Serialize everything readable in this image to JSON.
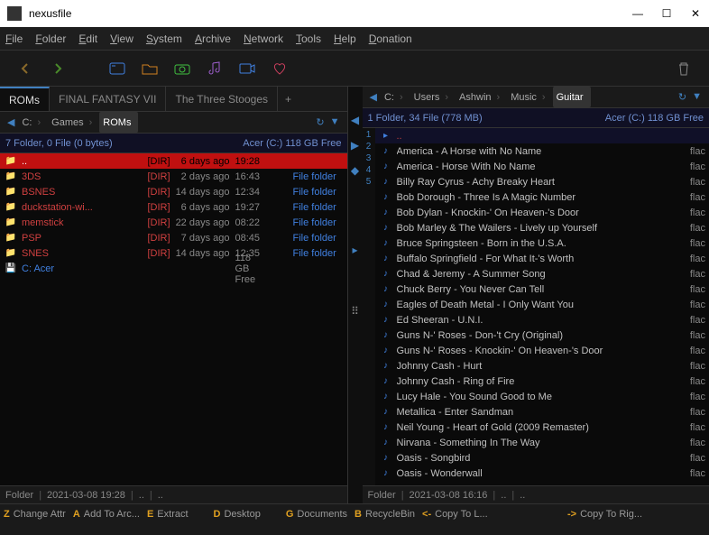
{
  "window": {
    "title": "nexusfile"
  },
  "menu": [
    "File",
    "Folder",
    "Edit",
    "View",
    "System",
    "Archive",
    "Network",
    "Tools",
    "Help",
    "Donation"
  ],
  "left": {
    "tabs": [
      {
        "label": "ROMs",
        "active": true
      },
      {
        "label": "FINAL FANTASY VII",
        "active": false
      },
      {
        "label": "The Three Stooges",
        "active": false
      }
    ],
    "breadcrumb": [
      "C:",
      "Games",
      "ROMs"
    ],
    "info_left": "7 Folder, 0 File (0 bytes)",
    "info_right": "Acer (C:) 118 GB Free",
    "rows": [
      {
        "name": "..",
        "dir": "[DIR]",
        "ago": "6 days ago",
        "time": "19:28",
        "bar": 100,
        "type": "",
        "sel": true,
        "icon": "folder"
      },
      {
        "name": "3DS",
        "dir": "[DIR]",
        "ago": "2 days ago",
        "time": "16:43",
        "bar": 0,
        "type": "File folder",
        "icon": "folder"
      },
      {
        "name": "BSNES",
        "dir": "[DIR]",
        "ago": "14 days ago",
        "time": "12:34",
        "bar": 0,
        "type": "File folder",
        "icon": "folder"
      },
      {
        "name": "duckstation-wi...",
        "dir": "[DIR]",
        "ago": "6 days ago",
        "time": "19:27",
        "bar": 0,
        "type": "File folder",
        "icon": "folder"
      },
      {
        "name": "memstick",
        "dir": "[DIR]",
        "ago": "22 days ago",
        "time": "08:22",
        "bar": 0,
        "type": "File folder",
        "icon": "folder"
      },
      {
        "name": "PSP",
        "dir": "[DIR]",
        "ago": "7 days ago",
        "time": "08:45",
        "bar": 0,
        "type": "File folder",
        "icon": "folder"
      },
      {
        "name": "SNES",
        "dir": "[DIR]",
        "ago": "14 days ago",
        "time": "12:35",
        "bar": 0,
        "type": "File folder",
        "icon": "folder"
      },
      {
        "name": "C: Acer",
        "dir": "",
        "ago": "",
        "time": "118 GB Free",
        "bar": 0,
        "type": "",
        "icon": "drive",
        "drive": true
      }
    ],
    "status": {
      "label": "Folder",
      "date": "2021-03-08 19:28",
      "extra": ".."
    }
  },
  "right": {
    "tabs": [
      {
        "label": "Guitar",
        "active": true
      }
    ],
    "breadcrumb": [
      "C:",
      "Users",
      "Ashwin",
      "Music",
      "Guitar"
    ],
    "info_left": "1 Folder, 34 File (778 MB)",
    "info_right": "Acer (C:) 118 GB Free",
    "rows": [
      {
        "name": "..",
        "up": true,
        "icon": "up"
      },
      {
        "name": "America - A Horse with No Name",
        "ext": "flac",
        "icon": "note"
      },
      {
        "name": "America - Horse With No Name",
        "ext": "flac",
        "icon": "note"
      },
      {
        "name": "Billy Ray Cyrus - Achy Breaky Heart",
        "ext": "flac",
        "icon": "note"
      },
      {
        "name": "Bob Dorough - Three Is A Magic Number",
        "ext": "flac",
        "icon": "note"
      },
      {
        "name": "Bob Dylan - Knockin-' On Heaven-'s Door",
        "ext": "flac",
        "icon": "note"
      },
      {
        "name": "Bob Marley & The Wailers - Lively up Yourself",
        "ext": "flac",
        "icon": "note"
      },
      {
        "name": "Bruce Springsteen - Born in the U.S.A.",
        "ext": "flac",
        "icon": "note"
      },
      {
        "name": "Buffalo Springfield - For What It-'s Worth",
        "ext": "flac",
        "icon": "note"
      },
      {
        "name": "Chad & Jeremy - A Summer Song",
        "ext": "flac",
        "icon": "note"
      },
      {
        "name": "Chuck Berry - You Never Can Tell",
        "ext": "flac",
        "icon": "note"
      },
      {
        "name": "Eagles of Death Metal - I Only Want You",
        "ext": "flac",
        "icon": "note"
      },
      {
        "name": "Ed Sheeran - U.N.I.",
        "ext": "flac",
        "icon": "note"
      },
      {
        "name": "Guns N-' Roses - Don-'t Cry (Original)",
        "ext": "flac",
        "icon": "note"
      },
      {
        "name": "Guns N-' Roses - Knockin-' On Heaven-'s Door",
        "ext": "flac",
        "icon": "note"
      },
      {
        "name": "Johnny Cash - Hurt",
        "ext": "flac",
        "icon": "note"
      },
      {
        "name": "Johnny Cash - Ring of Fire",
        "ext": "flac",
        "icon": "note"
      },
      {
        "name": "Lucy Hale - You Sound Good to Me",
        "ext": "flac",
        "icon": "note"
      },
      {
        "name": "Metallica - Enter Sandman",
        "ext": "flac",
        "icon": "note"
      },
      {
        "name": "Neil Young - Heart of Gold (2009 Remaster)",
        "ext": "flac",
        "icon": "note"
      },
      {
        "name": "Nirvana - Something In The Way",
        "ext": "flac",
        "icon": "note"
      },
      {
        "name": "Oasis - Songbird",
        "ext": "flac",
        "icon": "note"
      },
      {
        "name": "Oasis - Wonderwall",
        "ext": "flac",
        "icon": "note"
      }
    ],
    "status": {
      "label": "Folder",
      "date": "2021-03-08 16:16",
      "extra": ".."
    }
  },
  "functionbar": [
    {
      "key": "Z",
      "label": "Change Attr"
    },
    {
      "key": "A",
      "label": "Add To Arc..."
    },
    {
      "key": "E",
      "label": "Extract"
    },
    {
      "key": "D",
      "label": "Desktop"
    },
    {
      "key": "G",
      "label": "Documents"
    },
    {
      "key": "B",
      "label": "RecycleBin"
    },
    {
      "key": "<-",
      "label": "Copy To L..."
    },
    {
      "key": "->",
      "label": "Copy To Rig..."
    }
  ],
  "gutter_nums": [
    "1",
    "2",
    "3",
    "4",
    "5"
  ]
}
